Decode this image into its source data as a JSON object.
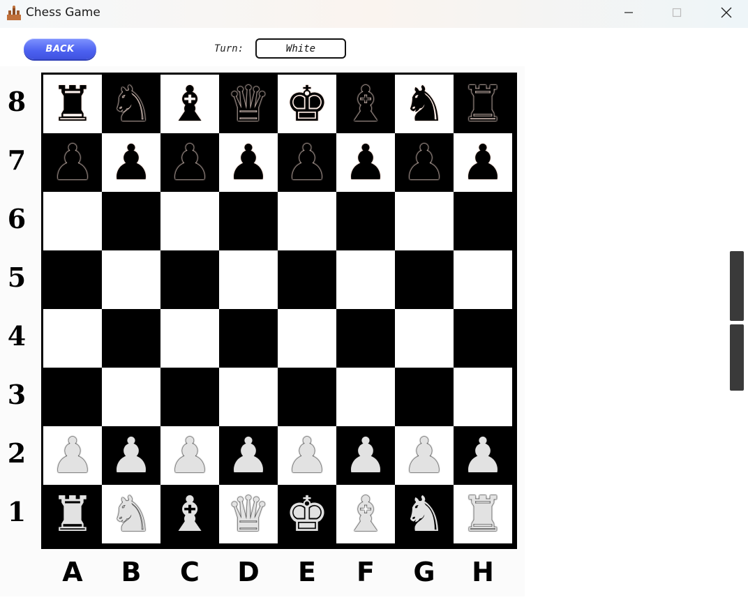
{
  "window": {
    "title": "Chess Game"
  },
  "controls": {
    "back_label": "BACK",
    "turn_label": "Turn:",
    "turn_value": "White"
  },
  "board": {
    "files": [
      "A",
      "B",
      "C",
      "D",
      "E",
      "F",
      "G",
      "H"
    ],
    "ranks": [
      "8",
      "7",
      "6",
      "5",
      "4",
      "3",
      "2",
      "1"
    ],
    "rows": [
      [
        "br",
        "bn",
        "bb",
        "bq",
        "bk",
        "bb",
        "bn",
        "br"
      ],
      [
        "bp",
        "bp",
        "bp",
        "bp",
        "bp",
        "bp",
        "bp",
        "bp"
      ],
      [
        "",
        "",
        "",
        "",
        "",
        "",
        "",
        ""
      ],
      [
        "",
        "",
        "",
        "",
        "",
        "",
        "",
        ""
      ],
      [
        "",
        "",
        "",
        "",
        "",
        "",
        "",
        ""
      ],
      [
        "",
        "",
        "",
        "",
        "",
        "",
        "",
        ""
      ],
      [
        "wp",
        "wp",
        "wp",
        "wp",
        "wp",
        "wp",
        "wp",
        "wp"
      ],
      [
        "wr",
        "wn",
        "wb",
        "wq",
        "wk",
        "wb",
        "wn",
        "wr"
      ]
    ]
  },
  "colors": {
    "light_square": "#ffffff",
    "dark_square": "#000000",
    "back_button": "#4c61f0"
  }
}
